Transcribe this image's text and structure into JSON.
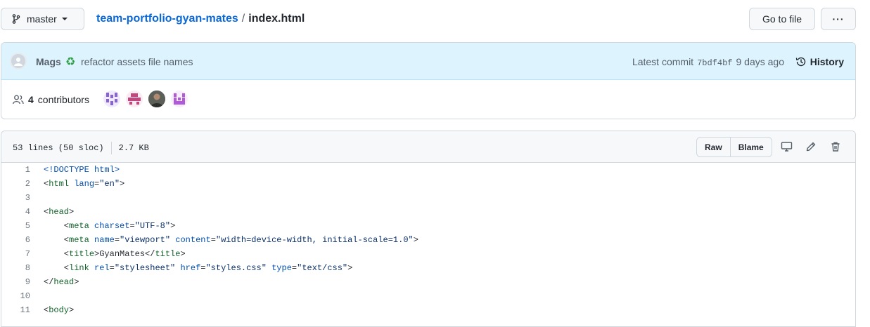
{
  "branch": {
    "label": "master",
    "icon": "git-branch-icon"
  },
  "breadcrumb": {
    "repo": "team-portfolio-gyan-mates",
    "separator": "/",
    "file": "index.html"
  },
  "actions": {
    "go_to_file": "Go to file",
    "more": "···"
  },
  "commit": {
    "author": "Mags",
    "emoji": "♻",
    "message": "refactor assets file names",
    "latest_label": "Latest commit",
    "sha": "7bdf4bf",
    "time": "9 days ago",
    "history_label": "History"
  },
  "contributors": {
    "count": "4",
    "label": "contributors"
  },
  "file": {
    "lines_info": "53 lines (50 sloc)",
    "size": "2.7 KB",
    "raw_label": "Raw",
    "blame_label": "Blame"
  },
  "code_lines": [
    {
      "n": "1",
      "parts": [
        [
          "doc",
          "<!DOCTYPE html>"
        ]
      ]
    },
    {
      "n": "2",
      "parts": [
        [
          "plain",
          "<"
        ],
        [
          "tag",
          "html"
        ],
        [
          "plain",
          " "
        ],
        [
          "attr",
          "lang"
        ],
        [
          "plain",
          "="
        ],
        [
          "str",
          "\"en\""
        ],
        [
          "plain",
          ">"
        ]
      ]
    },
    {
      "n": "3",
      "parts": []
    },
    {
      "n": "4",
      "parts": [
        [
          "plain",
          "<"
        ],
        [
          "tag",
          "head"
        ],
        [
          "plain",
          ">"
        ]
      ]
    },
    {
      "n": "5",
      "parts": [
        [
          "plain",
          "    <"
        ],
        [
          "tag",
          "meta"
        ],
        [
          "plain",
          " "
        ],
        [
          "attr",
          "charset"
        ],
        [
          "plain",
          "="
        ],
        [
          "str",
          "\"UTF-8\""
        ],
        [
          "plain",
          ">"
        ]
      ]
    },
    {
      "n": "6",
      "parts": [
        [
          "plain",
          "    <"
        ],
        [
          "tag",
          "meta"
        ],
        [
          "plain",
          " "
        ],
        [
          "attr",
          "name"
        ],
        [
          "plain",
          "="
        ],
        [
          "str",
          "\"viewport\""
        ],
        [
          "plain",
          " "
        ],
        [
          "attr",
          "content"
        ],
        [
          "plain",
          "="
        ],
        [
          "str",
          "\"width=device-width, initial-scale=1.0\""
        ],
        [
          "plain",
          ">"
        ]
      ]
    },
    {
      "n": "7",
      "parts": [
        [
          "plain",
          "    <"
        ],
        [
          "tag",
          "title"
        ],
        [
          "plain",
          ">GyanMates</"
        ],
        [
          "tag",
          "title"
        ],
        [
          "plain",
          ">"
        ]
      ]
    },
    {
      "n": "8",
      "parts": [
        [
          "plain",
          "    <"
        ],
        [
          "tag",
          "link"
        ],
        [
          "plain",
          " "
        ],
        [
          "attr",
          "rel"
        ],
        [
          "plain",
          "="
        ],
        [
          "str",
          "\"stylesheet\""
        ],
        [
          "plain",
          " "
        ],
        [
          "attr",
          "href"
        ],
        [
          "plain",
          "="
        ],
        [
          "str",
          "\"styles.css\""
        ],
        [
          "plain",
          " "
        ],
        [
          "attr",
          "type"
        ],
        [
          "plain",
          "="
        ],
        [
          "str",
          "\"text/css\""
        ],
        [
          "plain",
          ">"
        ]
      ]
    },
    {
      "n": "9",
      "parts": [
        [
          "plain",
          "</"
        ],
        [
          "tag",
          "head"
        ],
        [
          "plain",
          ">"
        ]
      ]
    },
    {
      "n": "10",
      "parts": []
    },
    {
      "n": "11",
      "parts": [
        [
          "plain",
          "<"
        ],
        [
          "tag",
          "body"
        ],
        [
          "plain",
          ">"
        ]
      ]
    }
  ]
}
